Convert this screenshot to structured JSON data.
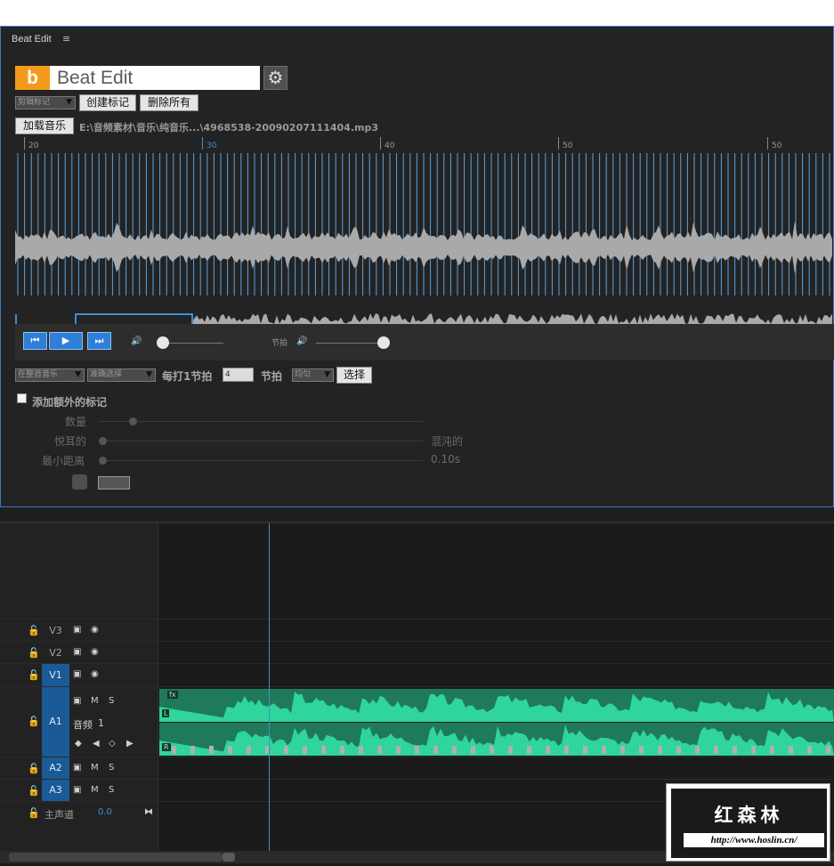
{
  "panel": {
    "tab_title": "Beat Edit",
    "menu_icon": "≡",
    "logo_letter": "b",
    "logo_text": "Beat Edit",
    "gear_icon": "gear-icon"
  },
  "marker_row": {
    "marker_type": "剪辑标记",
    "create_label": "创建标记",
    "delete_label": "删除所有"
  },
  "music": {
    "load_label": "加载音乐",
    "file_path": "E:\\音频素材\\音乐\\纯音乐...\\4968538-20090207111404.mp3"
  },
  "ruler": {
    "labels": [
      "20",
      "30",
      "40",
      "50",
      "50"
    ]
  },
  "transport": {
    "prev_icon": "skip-back-icon",
    "play_icon": "play-icon",
    "next_icon": "skip-forward-icon",
    "music_volume_level": 0.05,
    "beat_label": "节拍",
    "beat_volume_level": 1.0
  },
  "analysis": {
    "source_option": "在整首音乐",
    "select_option": "准确选择",
    "every_label": "每打1节拍",
    "beat_count": "4",
    "beat_unit": "节拍",
    "distribution_option": "均匀",
    "select_button": "选择"
  },
  "extra": {
    "add_extra_label": "添加额外的标记",
    "amount_label": "数量",
    "pleasant_label": "悦耳的",
    "chaotic_label": "混沌的",
    "min_distance_label": "最小距离",
    "min_distance_value": "0.10s"
  },
  "timeline": {
    "tracks": [
      {
        "name": "V1",
        "label": "V3"
      },
      {
        "name": "V2",
        "label": "V2"
      },
      {
        "name": "V1",
        "label": "V1"
      }
    ],
    "audio_label": "A1",
    "audio_clip_name": "音频",
    "audio_clip_num": "1",
    "a2_label": "A2",
    "a3_label": "A3",
    "master_label": "主声道",
    "master_value": "0.0",
    "m_label": "M",
    "s_label": "S",
    "fx_label": "fx",
    "l_label": "L",
    "r_label": "R"
  },
  "watermark": {
    "title": "红森林",
    "url": "http://www.hoslin.cn/"
  },
  "colors": {
    "accent_blue": "#2e7fd8",
    "waveform_gray": "#a9a9a9",
    "clip_green": "#2fd59a",
    "logo_orange": "#f39a1e"
  }
}
